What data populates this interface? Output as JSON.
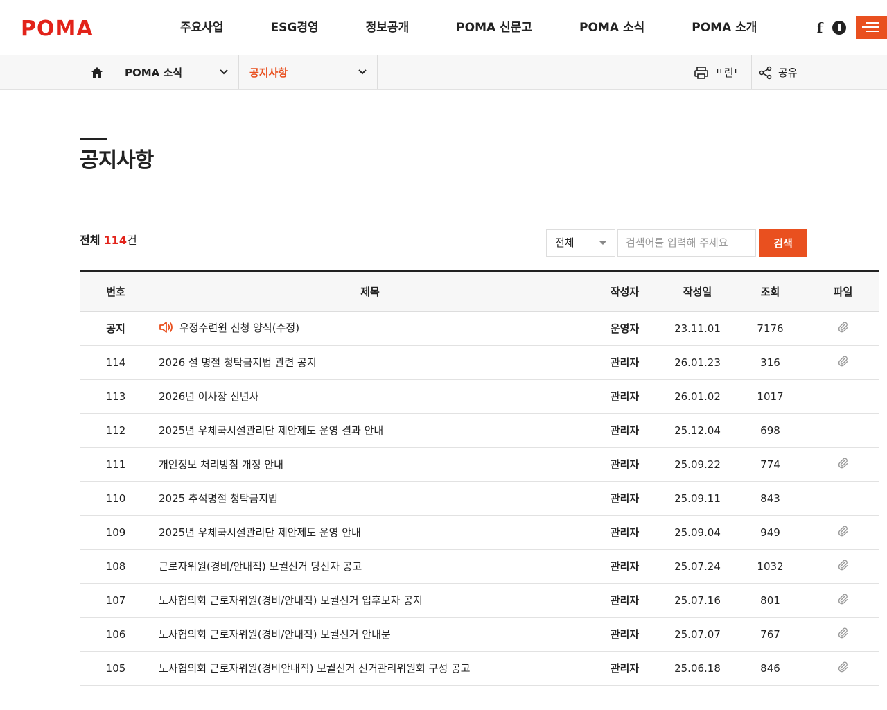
{
  "header": {
    "logo_text": "POMA",
    "nav": [
      "주요사업",
      "ESG경영",
      "정보공개",
      "POMA 신문고",
      "POMA 소식",
      "POMA 소개"
    ],
    "sns": {
      "facebook_label": "f"
    },
    "menu_icon": "hamburger-menu-icon"
  },
  "location": {
    "home_icon": "home-icon",
    "depth1": "POMA 소식",
    "depth2": "공지사항",
    "print_label": "프린트",
    "share_label": "공유"
  },
  "page": {
    "title": "공지사항"
  },
  "board": {
    "total_prefix": "전체",
    "total_count": "114",
    "total_unit": "건",
    "search_select_value": "전체",
    "search_placeholder": "검색어를 입력해 주세요",
    "search_button": "검색",
    "columns": [
      "번호",
      "제목",
      "작성자",
      "작성일",
      "조회",
      "파일"
    ],
    "rows": [
      {
        "no": "공지",
        "title": "우정수련원 신청 양식(수정)",
        "writer": "운영자",
        "date": "23.11.01",
        "views": "7176",
        "file": true,
        "notice": true
      },
      {
        "no": "114",
        "title": "2026 설 명절 청탁금지법 관련 공지",
        "writer": "관리자",
        "date": "26.01.23",
        "views": "316",
        "file": true,
        "notice": false
      },
      {
        "no": "113",
        "title": "2026년 이사장 신년사",
        "writer": "관리자",
        "date": "26.01.02",
        "views": "1017",
        "file": false,
        "notice": false
      },
      {
        "no": "112",
        "title": "2025년 우체국시설관리단 제안제도 운영 결과 안내",
        "writer": "관리자",
        "date": "25.12.04",
        "views": "698",
        "file": false,
        "notice": false
      },
      {
        "no": "111",
        "title": "개인정보 처리방침 개정 안내",
        "writer": "관리자",
        "date": "25.09.22",
        "views": "774",
        "file": true,
        "notice": false
      },
      {
        "no": "110",
        "title": "2025 추석명절 청탁금지법",
        "writer": "관리자",
        "date": "25.09.11",
        "views": "843",
        "file": false,
        "notice": false
      },
      {
        "no": "109",
        "title": "2025년 우체국시설관리단 제안제도 운영 안내",
        "writer": "관리자",
        "date": "25.09.04",
        "views": "949",
        "file": true,
        "notice": false
      },
      {
        "no": "108",
        "title": "근로자위원(경비/안내직) 보궐선거 당선자 공고",
        "writer": "관리자",
        "date": "25.07.24",
        "views": "1032",
        "file": true,
        "notice": false
      },
      {
        "no": "107",
        "title": "노사협의회 근로자위원(경비/안내직) 보궐선거 입후보자 공지",
        "writer": "관리자",
        "date": "25.07.16",
        "views": "801",
        "file": true,
        "notice": false
      },
      {
        "no": "106",
        "title": "노사협의회 근로자위원(경비/안내직) 보궐선거 안내문",
        "writer": "관리자",
        "date": "25.07.07",
        "views": "767",
        "file": true,
        "notice": false
      },
      {
        "no": "105",
        "title": "노사협의회 근로자위원(경비안내직) 보궐선거 선거관리위원회 구성 공고",
        "writer": "관리자",
        "date": "25.06.18",
        "views": "846",
        "file": true,
        "notice": false
      }
    ]
  },
  "colors": {
    "accent": "#e9501f",
    "count": "#e2231a",
    "logo": "#e2231a"
  }
}
